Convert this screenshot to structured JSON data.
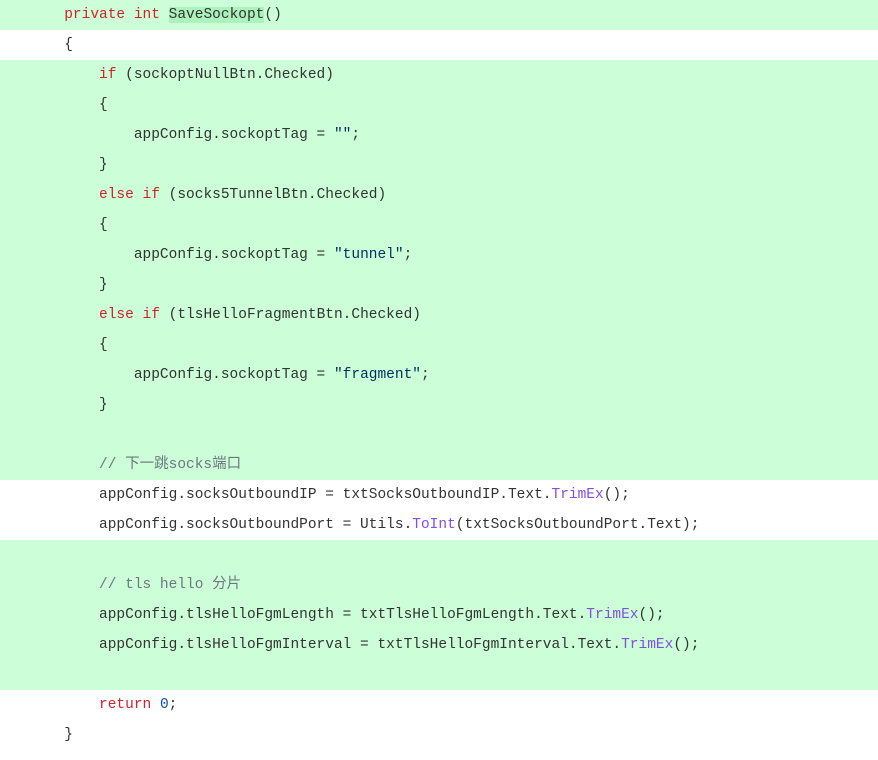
{
  "code": {
    "lines": [
      {
        "indent": "      ",
        "added": true,
        "tokens": [
          {
            "t": "private",
            "c": "kw"
          },
          {
            "t": " "
          },
          {
            "t": "int",
            "c": "type"
          },
          {
            "t": " "
          },
          {
            "t": "SaveSockopt",
            "c": "method-def highlight-name"
          },
          {
            "t": "()"
          }
        ]
      },
      {
        "indent": "      ",
        "added": false,
        "tokens": [
          {
            "t": "{"
          }
        ]
      },
      {
        "indent": "          ",
        "added": true,
        "tokens": [
          {
            "t": "if",
            "c": "kw"
          },
          {
            "t": " (sockoptNullBtn.Checked)"
          }
        ]
      },
      {
        "indent": "          ",
        "added": true,
        "tokens": [
          {
            "t": "{"
          }
        ]
      },
      {
        "indent": "              ",
        "added": true,
        "tokens": [
          {
            "t": "appConfig.sockoptTag = "
          },
          {
            "t": "\"\"",
            "c": "str"
          },
          {
            "t": ";"
          }
        ]
      },
      {
        "indent": "          ",
        "added": true,
        "tokens": [
          {
            "t": "}"
          }
        ]
      },
      {
        "indent": "          ",
        "added": true,
        "tokens": [
          {
            "t": "else",
            "c": "kw"
          },
          {
            "t": " "
          },
          {
            "t": "if",
            "c": "kw"
          },
          {
            "t": " (socks5TunnelBtn.Checked)"
          }
        ]
      },
      {
        "indent": "          ",
        "added": true,
        "tokens": [
          {
            "t": "{"
          }
        ]
      },
      {
        "indent": "              ",
        "added": true,
        "tokens": [
          {
            "t": "appConfig.sockoptTag = "
          },
          {
            "t": "\"tunnel\"",
            "c": "str"
          },
          {
            "t": ";"
          }
        ]
      },
      {
        "indent": "          ",
        "added": true,
        "tokens": [
          {
            "t": "}"
          }
        ]
      },
      {
        "indent": "          ",
        "added": true,
        "tokens": [
          {
            "t": "else",
            "c": "kw"
          },
          {
            "t": " "
          },
          {
            "t": "if",
            "c": "kw"
          },
          {
            "t": " (tlsHelloFragmentBtn.Checked)"
          }
        ]
      },
      {
        "indent": "          ",
        "added": true,
        "tokens": [
          {
            "t": "{"
          }
        ]
      },
      {
        "indent": "              ",
        "added": true,
        "tokens": [
          {
            "t": "appConfig.sockoptTag = "
          },
          {
            "t": "\"fragment\"",
            "c": "str"
          },
          {
            "t": ";"
          }
        ]
      },
      {
        "indent": "          ",
        "added": true,
        "tokens": [
          {
            "t": "}"
          }
        ]
      },
      {
        "indent": "",
        "added": true,
        "tokens": []
      },
      {
        "indent": "          ",
        "added": true,
        "tokens": [
          {
            "t": "// 下一跳socks端口",
            "c": "comment"
          }
        ]
      },
      {
        "indent": "          ",
        "added": false,
        "tokens": [
          {
            "t": "appConfig.socksOutboundIP = txtSocksOutboundIP.Text."
          },
          {
            "t": "TrimEx",
            "c": "method-call"
          },
          {
            "t": "();"
          }
        ]
      },
      {
        "indent": "          ",
        "added": false,
        "tokens": [
          {
            "t": "appConfig.socksOutboundPort = Utils."
          },
          {
            "t": "ToInt",
            "c": "method-call"
          },
          {
            "t": "(txtSocksOutboundPort.Text);"
          }
        ]
      },
      {
        "indent": "",
        "added": true,
        "tokens": []
      },
      {
        "indent": "          ",
        "added": true,
        "tokens": [
          {
            "t": "// tls hello 分片",
            "c": "comment"
          }
        ]
      },
      {
        "indent": "          ",
        "added": true,
        "tokens": [
          {
            "t": "appConfig.tlsHelloFgmLength = txtTlsHelloFgmLength.Text."
          },
          {
            "t": "TrimEx",
            "c": "method-call"
          },
          {
            "t": "();"
          }
        ]
      },
      {
        "indent": "          ",
        "added": true,
        "tokens": [
          {
            "t": "appConfig.tlsHelloFgmInterval = txtTlsHelloFgmInterval.Text."
          },
          {
            "t": "TrimEx",
            "c": "method-call"
          },
          {
            "t": "();"
          }
        ]
      },
      {
        "indent": "",
        "added": true,
        "tokens": []
      },
      {
        "indent": "          ",
        "added": false,
        "tokens": [
          {
            "t": "return",
            "c": "kw"
          },
          {
            "t": " "
          },
          {
            "t": "0",
            "c": "num"
          },
          {
            "t": ";"
          }
        ]
      },
      {
        "indent": "      ",
        "added": false,
        "tokens": [
          {
            "t": "}"
          }
        ]
      }
    ]
  }
}
